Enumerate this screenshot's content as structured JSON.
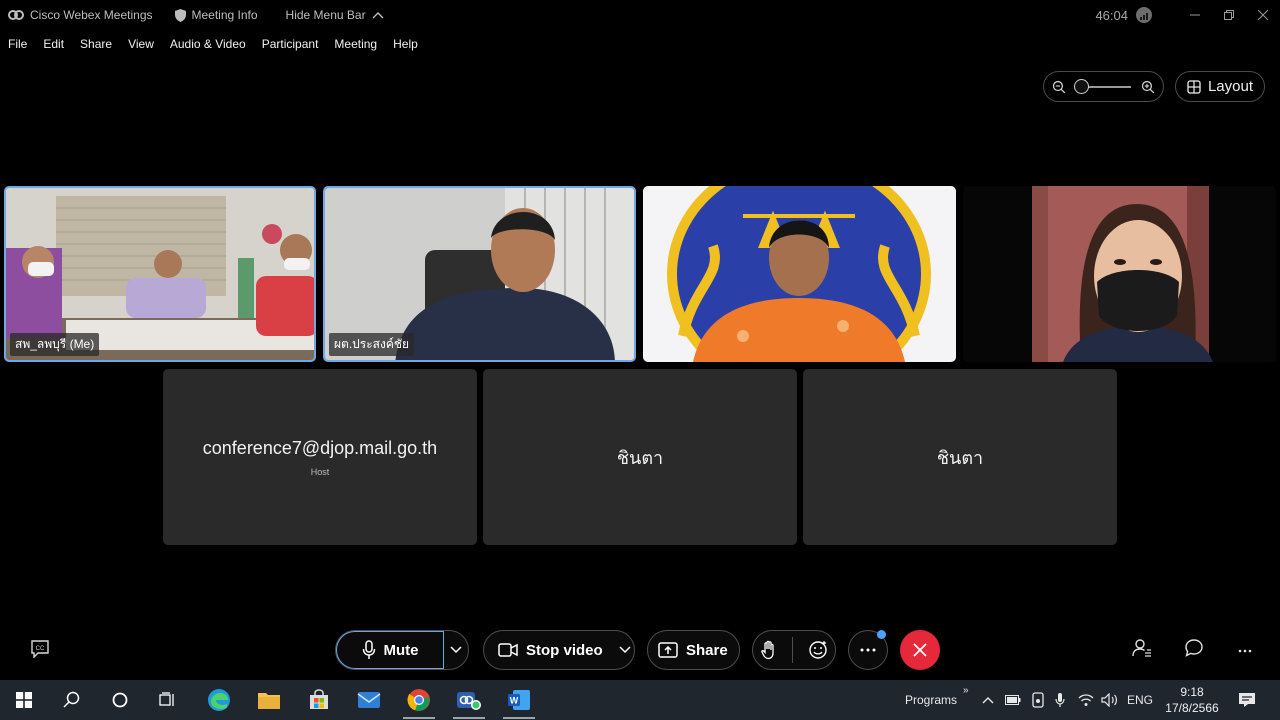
{
  "titlebar": {
    "app_name": "Cisco Webex Meetings",
    "meeting_info": "Meeting Info",
    "hide_menu": "Hide Menu Bar",
    "timer": "46:04"
  },
  "menu": [
    "File",
    "Edit",
    "Share",
    "View",
    "Audio & Video",
    "Participant",
    "Meeting",
    "Help"
  ],
  "layout_label": "Layout",
  "zoom_level": 0.1,
  "video_tiles": [
    {
      "name": "สพ_ลพบุรี (Me)"
    },
    {
      "name": "ผต.ประสงค์ชัย"
    },
    {
      "name": ""
    },
    {
      "name": ""
    }
  ],
  "placeholder_tiles": [
    {
      "name": "conference7@djop.mail.go.th",
      "role": "Host"
    },
    {
      "name": "ชินตา",
      "role": ""
    },
    {
      "name": "ชินตา",
      "role": ""
    }
  ],
  "controls": {
    "mute": "Mute",
    "stop_video": "Stop video",
    "share": "Share"
  },
  "taskbar": {
    "programs": "Programs",
    "language": "ENG",
    "time": "9:18",
    "date": "17/8/2566"
  },
  "colors": {
    "active_border": "#6ea8e6",
    "leave": "#e5283a",
    "badge": "#4aa3ff"
  }
}
